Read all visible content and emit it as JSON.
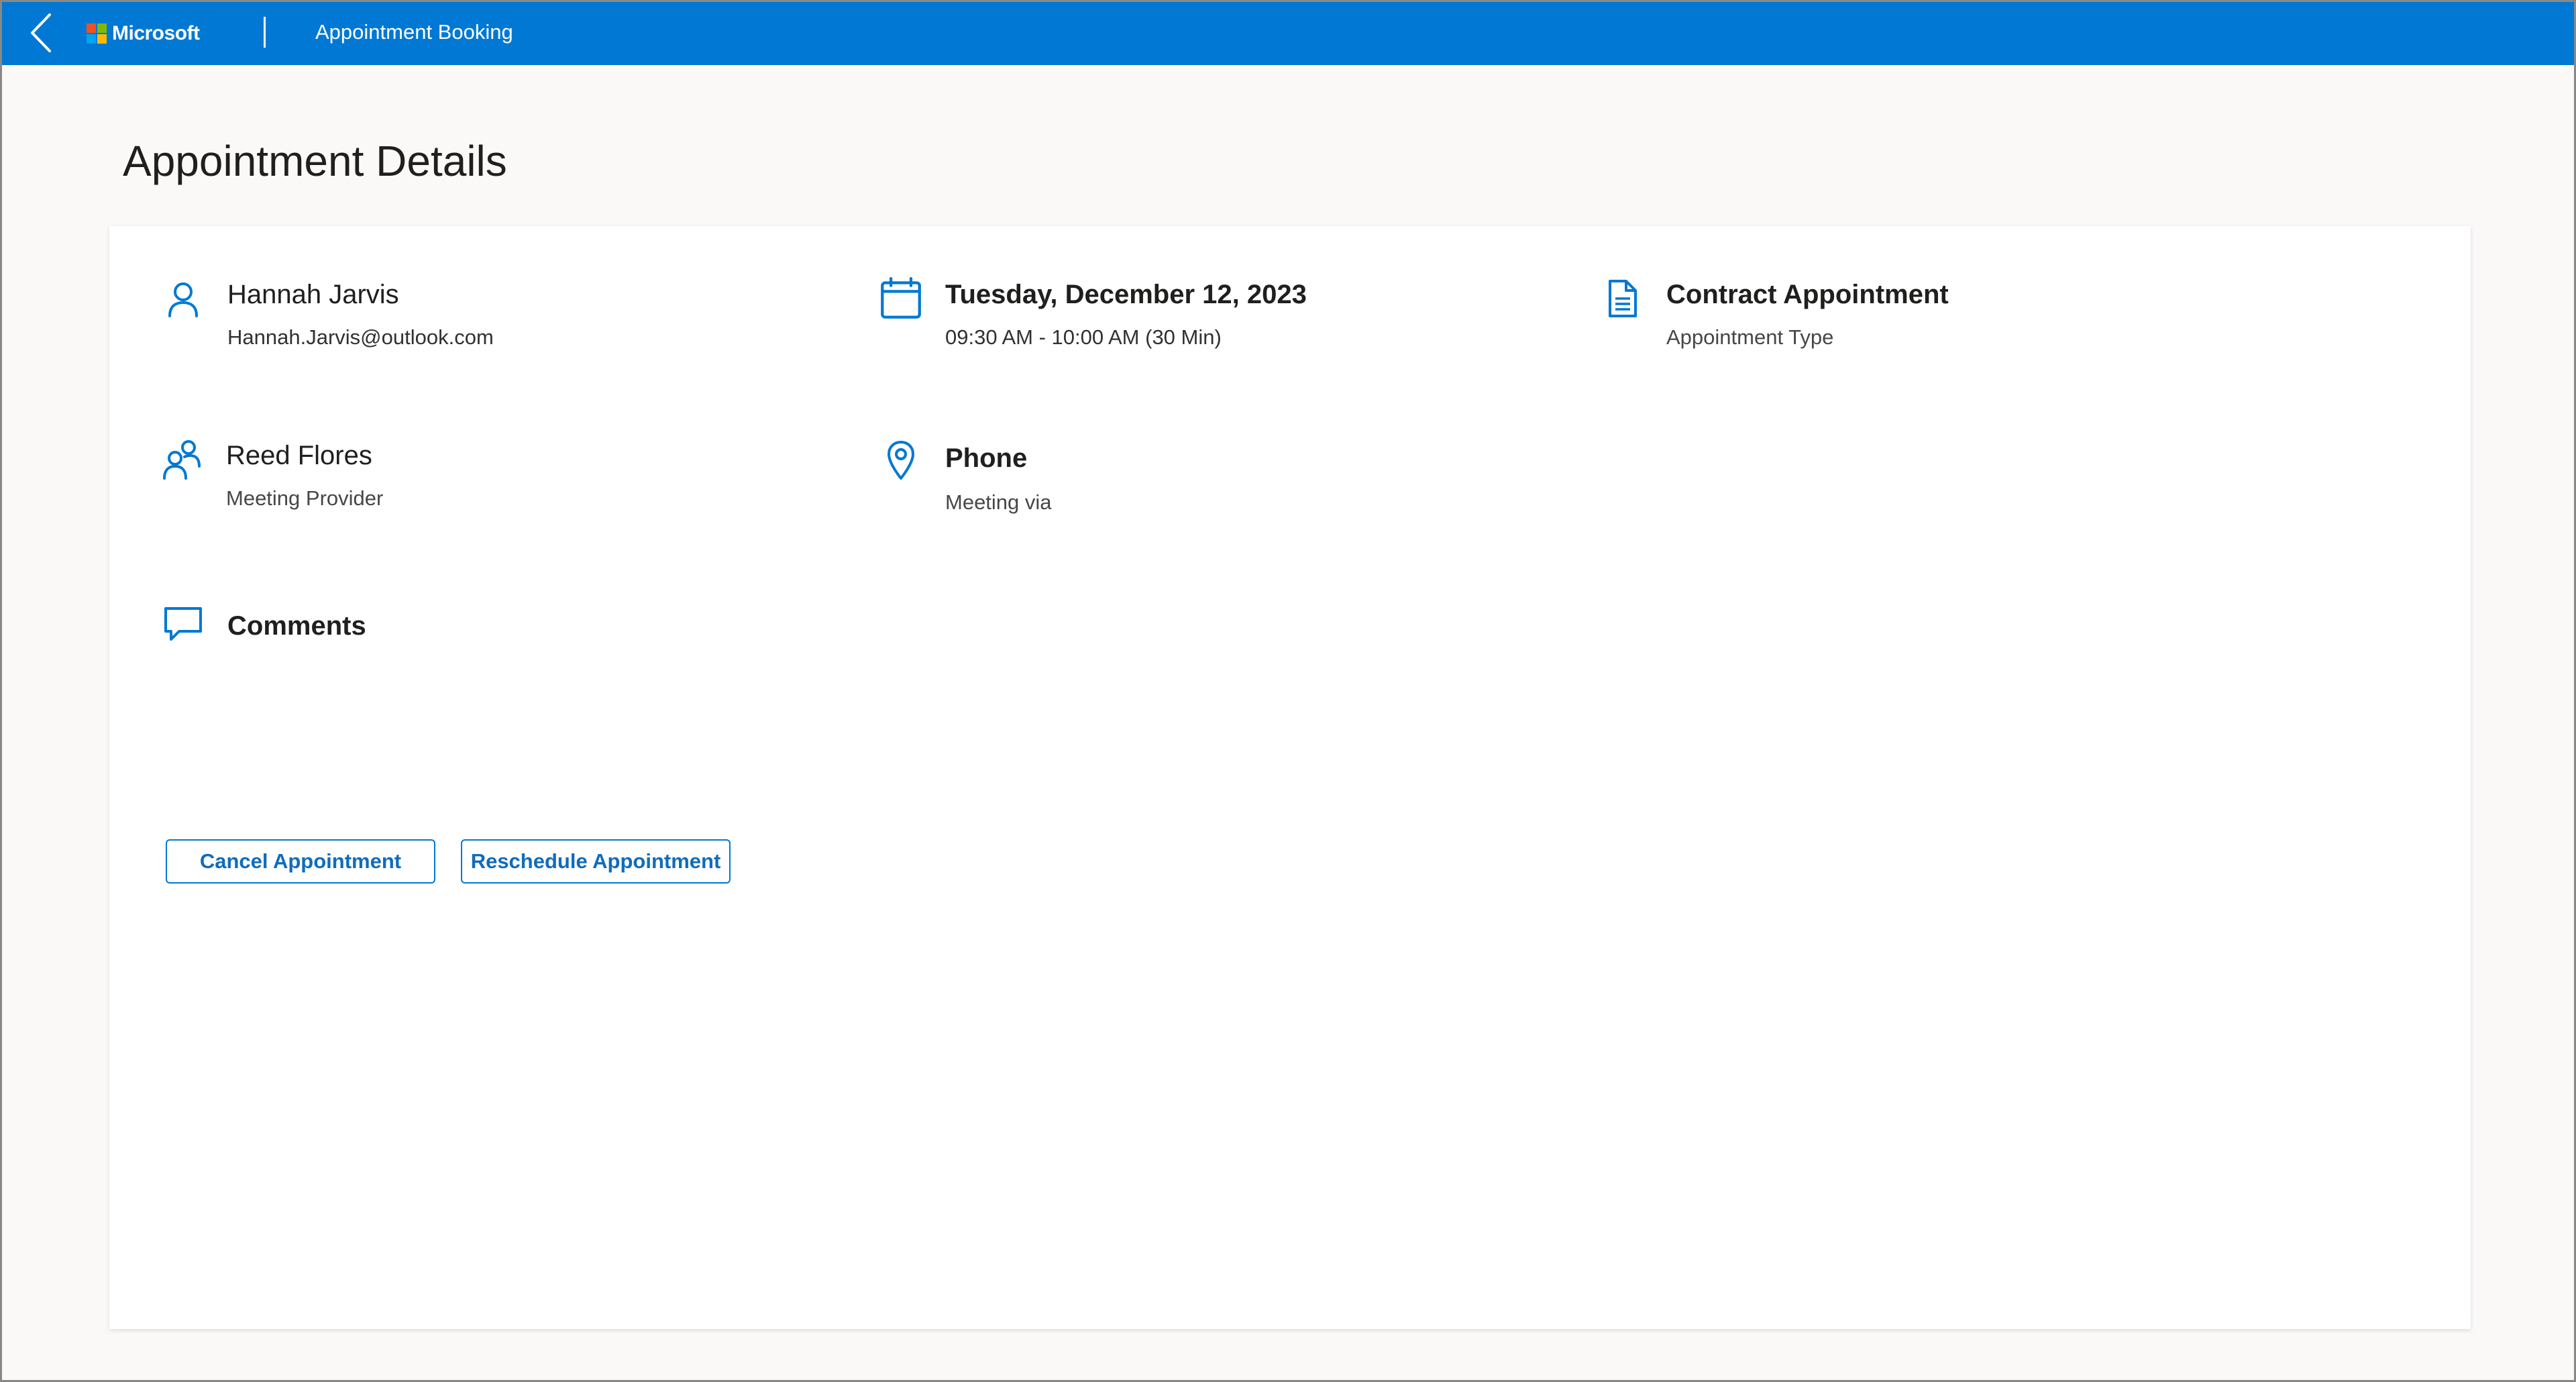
{
  "header": {
    "brand": "Microsoft",
    "title": "Appointment Booking",
    "accent_color": "#0078d4",
    "logo_colors": [
      "#f25022",
      "#7fba00",
      "#00a4ef",
      "#ffb900"
    ]
  },
  "page": {
    "title": "Appointment Details"
  },
  "details": {
    "customer": {
      "icon": "person-icon",
      "name": "Hannah Jarvis",
      "email": "Hannah.Jarvis@outlook.com"
    },
    "date": {
      "icon": "calendar-icon",
      "title": "Tuesday, December 12, 2023",
      "time": "09:30 AM - 10:00 AM (30 Min)"
    },
    "type": {
      "icon": "document-icon",
      "title": "Contract Appointment",
      "label": "Appointment Type"
    },
    "provider": {
      "icon": "people-icon",
      "name": "Reed Flores",
      "label": "Meeting Provider"
    },
    "location": {
      "icon": "location-pin-icon",
      "title": "Phone",
      "label": "Meeting via"
    },
    "comments": {
      "icon": "comment-icon",
      "title": "Comments"
    }
  },
  "actions": {
    "cancel_label": "Cancel Appointment",
    "reschedule_label": "Reschedule Appointment"
  }
}
